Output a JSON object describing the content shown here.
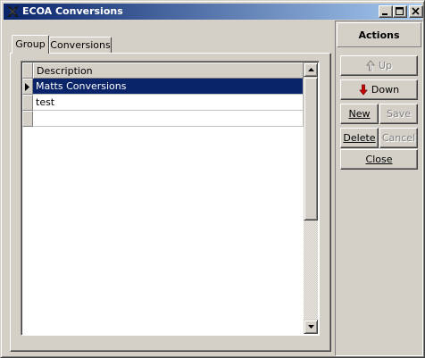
{
  "window": {
    "title": "ECOA Conversions"
  },
  "tabs": [
    {
      "label": "Group",
      "active": true
    },
    {
      "label": "Conversions",
      "active": false
    }
  ],
  "grid": {
    "column_header": "Description",
    "rows": [
      {
        "description": "Matts Conversions",
        "selected": true
      },
      {
        "description": "test",
        "selected": false
      },
      {
        "description": "",
        "selected": false
      }
    ]
  },
  "actions": {
    "header": "Actions",
    "up_label": "Up",
    "down_label": "Down",
    "new_label": "New",
    "save_label": "Save",
    "delete_label": "Delete",
    "cancel_label": "Cancel",
    "close_label": "Close"
  },
  "colors": {
    "titlebar_start": "#0a246a",
    "titlebar_end": "#a6caf0",
    "selection": "#0a246a",
    "down_arrow": "#cc0000"
  },
  "icons": {
    "app": "ecoa-app-icon",
    "up": "up-arrow-icon",
    "down": "down-arrow-icon",
    "row_pointer": "row-pointer-icon"
  }
}
